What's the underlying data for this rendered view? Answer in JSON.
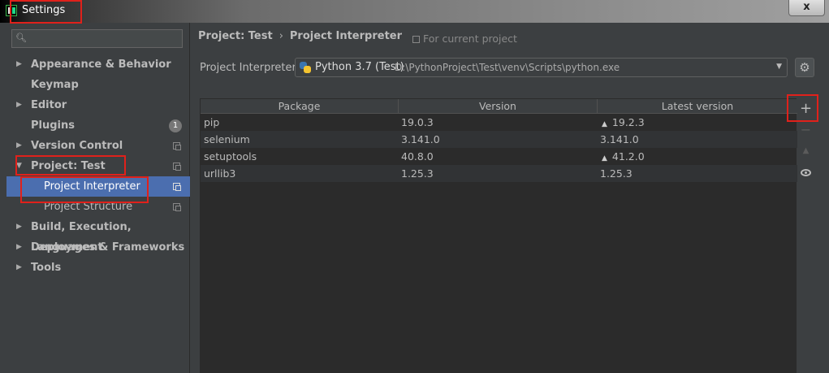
{
  "window": {
    "title": "Settings",
    "close_label": "x"
  },
  "sidebar": {
    "search_placeholder": "",
    "items": [
      {
        "label": "Appearance & Behavior",
        "expandable": true
      },
      {
        "label": "Keymap",
        "expandable": false
      },
      {
        "label": "Editor",
        "expandable": true
      },
      {
        "label": "Plugins",
        "expandable": false,
        "badge": "1"
      },
      {
        "label": "Version Control",
        "expandable": true
      },
      {
        "label": "Project: Test",
        "expandable": true,
        "expanded": true
      },
      {
        "label": "Project Interpreter",
        "child": true,
        "selected": true
      },
      {
        "label": "Project Structure",
        "child": true
      },
      {
        "label": "Build, Execution, Deployment",
        "expandable": true
      },
      {
        "label": "Languages & Frameworks",
        "expandable": true
      },
      {
        "label": "Tools",
        "expandable": true
      }
    ]
  },
  "main": {
    "breadcrumb": [
      "Project: Test",
      "Project Interpreter"
    ],
    "breadcrumb_sep": "›",
    "scope_label": "For current project",
    "interpreter_label": "Project Interpreter:",
    "interpreter_name": "Python 3.7 (Test)",
    "interpreter_path": "D:\\PythonProject\\Test\\venv\\Scripts\\python.exe",
    "table": {
      "columns": [
        "Package",
        "Version",
        "Latest version"
      ],
      "rows": [
        {
          "package": "pip",
          "version": "19.0.3",
          "latest": "19.2.3",
          "upgrade": true
        },
        {
          "package": "selenium",
          "version": "3.141.0",
          "latest": "3.141.0",
          "upgrade": false
        },
        {
          "package": "setuptools",
          "version": "40.8.0",
          "latest": "41.2.0",
          "upgrade": true
        },
        {
          "package": "urllib3",
          "version": "1.25.3",
          "latest": "1.25.3",
          "upgrade": false
        }
      ]
    },
    "toolbar": {
      "add": "+",
      "remove": "−",
      "upgrade": "▲"
    }
  },
  "icons": {
    "search": "search-icon",
    "expand": "triangle-right-icon",
    "expanded": "triangle-down-icon",
    "project_scope": "copy-icon",
    "python": "python-icon",
    "settings": "gear-icon",
    "show": "eye-icon",
    "upgrade": "triangle-up-icon"
  },
  "colors": {
    "selection": "#4b6eaf",
    "background": "#3c3f41",
    "table_bg": "#2b2b2b",
    "annotation": "#e0211b"
  }
}
